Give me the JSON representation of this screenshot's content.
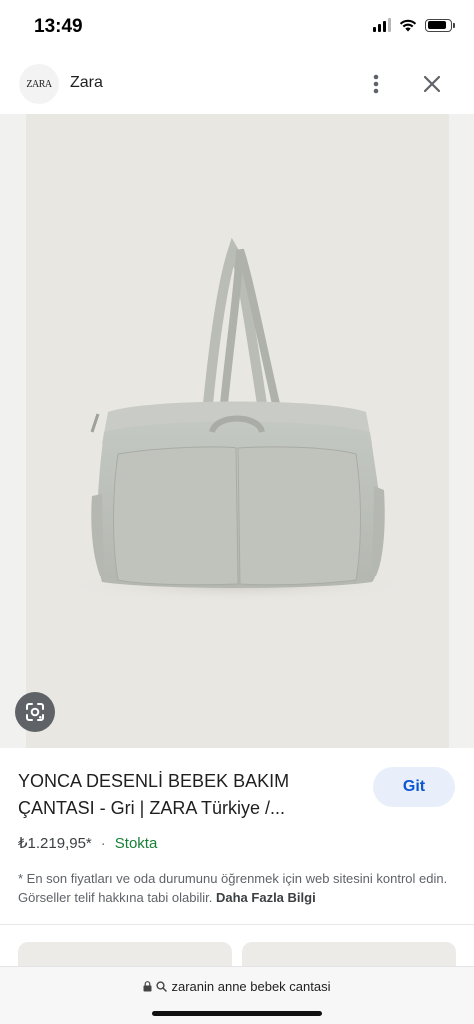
{
  "status_bar": {
    "time": "13:49",
    "battery_level": 0.85,
    "icons": [
      "signal-icon",
      "wifi-icon",
      "battery-icon"
    ]
  },
  "header": {
    "logo_text": "ZARA",
    "site_name": "Zara",
    "more_icon": "more-vert-icon",
    "close_icon": "close-icon"
  },
  "image": {
    "lens_icon": "lens-icon"
  },
  "product": {
    "title": "YONCA DESENLİ BEBEK BAKIM ÇANTASI - Gri | ZARA Türkiye /...",
    "action_label": "Git",
    "price": "₺1.219,95*",
    "separator": "·",
    "stock": "Stokta",
    "disclaimer": "* En son fiyatları ve oda durumunu öğrenmek için web sitesini kontrol edin. Görseller telif hakkına tabi olabilir.",
    "more_info": "Daha Fazla Bilgi"
  },
  "address_bar": {
    "url": "zaranin anne bebek cantasi"
  },
  "colors": {
    "accent": "#0b57d0",
    "accent_bg": "#e8effb",
    "stock_green": "#188038",
    "image_bg": "#e9e7e2"
  }
}
